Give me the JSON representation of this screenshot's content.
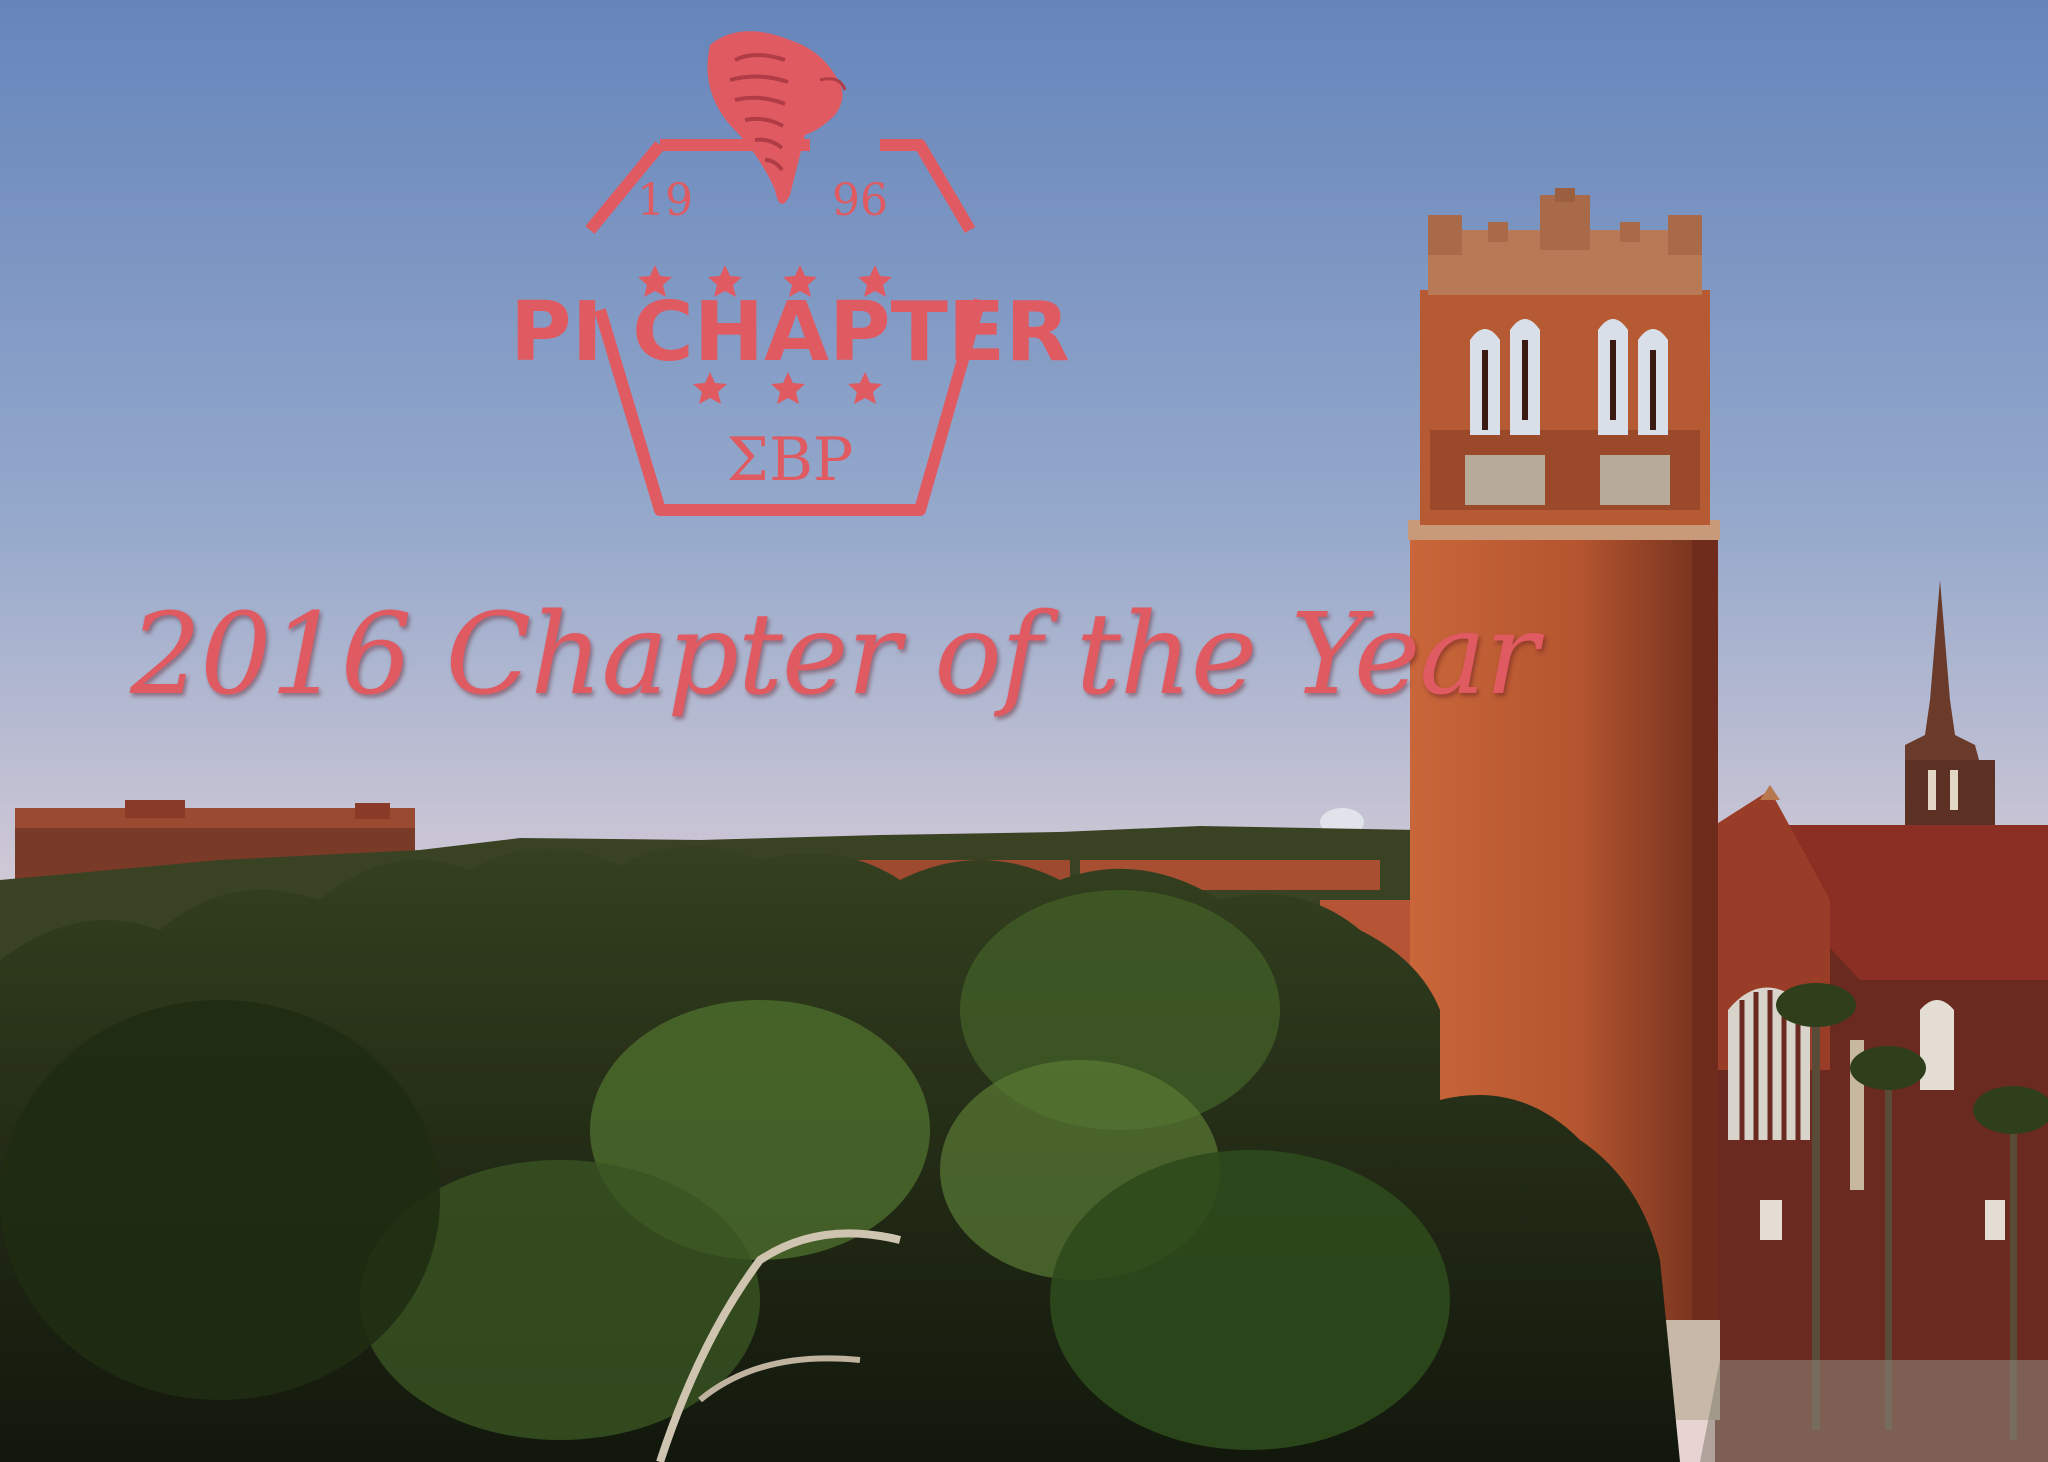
{
  "logo": {
    "year_left": "19",
    "year_right": "96",
    "chapter_name": "PI CHAPTER",
    "greek_letters": "ΣΒΡ",
    "mascot": "cobra-icon",
    "star_icon": "star-icon",
    "color": "#e05a62"
  },
  "tagline": "2016 Chapter of the Year",
  "colors": {
    "sky_top": "#6f8fbf",
    "sky_bottom": "#e4cfd3",
    "tower_brick": "#b5542d",
    "roof": "#8b2f25",
    "foliage": "#2a3a1c"
  }
}
